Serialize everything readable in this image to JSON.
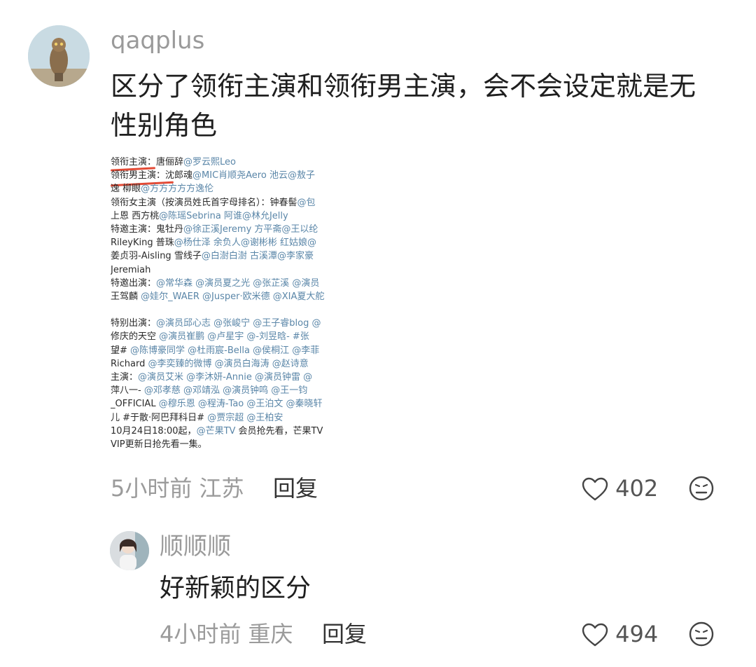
{
  "comment1": {
    "username": "qaqplus",
    "text": "区分了领衔主演和领衔男主演，会不会设定就是无性别角色",
    "attached_image_lines": [
      [
        "领衔主演：唐俪辞",
        "@罗云熙Leo"
      ],
      [
        "领衔男主演：沈郎魂",
        "@MIC肖顺尧Aero 池云",
        "@敖子"
      ],
      [
        "逸 柳眼",
        "@方方方方方逸伦"
      ],
      [
        "领衔女主演（按演员姓氏首字母排名）：钟春髻",
        "@包"
      ],
      [
        "上恩 西方桃",
        "@陈瑶Sebrina 阿谁",
        "@林允Jelly"
      ],
      [
        "特邀主演：鬼牡丹",
        "@徐正溪Jeremy 方平斋",
        "@王以纶"
      ],
      [
        "RileyKing 普珠",
        "@杨仕泽 余负人",
        "@谢彬彬 红姑娘",
        "@"
      ],
      [
        "姜贞羽-Aisling 雪线子",
        "@白澍白澍 古溪潭",
        "@李家豪"
      ],
      [
        "Jeremiah"
      ],
      [
        "特邀出演：",
        "@常华森 @演员夏之光 @张芷溪 @演员"
      ],
      [
        "王驾麟 ",
        "@娃尔_WAER @Jusper·欧米德 @XIA夏大舵"
      ],
      [
        ""
      ],
      [
        "特别出演：",
        "@演员邱心志 @张峻宁 @王子睿blog @"
      ],
      [
        "修庆的天空 ",
        "@演员崔鹏 @卢星宇 @-刘昱晗- #张"
      ],
      [
        "望# ",
        "@陈博豪同学 @杜雨宸-Bella @侯桐江 @李菲"
      ],
      [
        "Richard ",
        "@李奕臻的微博 @演员白海涛 @赵诗意"
      ],
      [
        "主演：",
        "@演员艾米 @李沐妍-Annie @演员钟雷 @"
      ],
      [
        "萍八一- ",
        "@邓孝慈 @邓靖泓 @演员钟鸣 @王一钧"
      ],
      [
        "_OFFICIAL ",
        "@穆乐恩 @程涛-Tao @王泊文 @秦晓轩"
      ],
      [
        "儿 #于散·阿巴拜科日# ",
        "@贾宗超 @王柏安"
      ],
      [
        "10月24日18:00起，",
        "@芒果TV",
        " 会员抢先看，芒果TV"
      ],
      [
        "VIP更新日抢先看一集。"
      ]
    ],
    "time_location": "5小时前 江苏",
    "reply_label": "回复",
    "like_count": "402"
  },
  "comment2": {
    "username": "顺顺顺",
    "text": "好新颖的区分",
    "time_location": "4小时前 重庆",
    "reply_label": "回复",
    "like_count": "494"
  },
  "icons": {
    "like": "heart-outline-icon",
    "dislike": "frown-face-icon"
  },
  "colors": {
    "mention": "#5a86a8",
    "underline": "#e34b36",
    "meta": "#9b9b9b"
  }
}
